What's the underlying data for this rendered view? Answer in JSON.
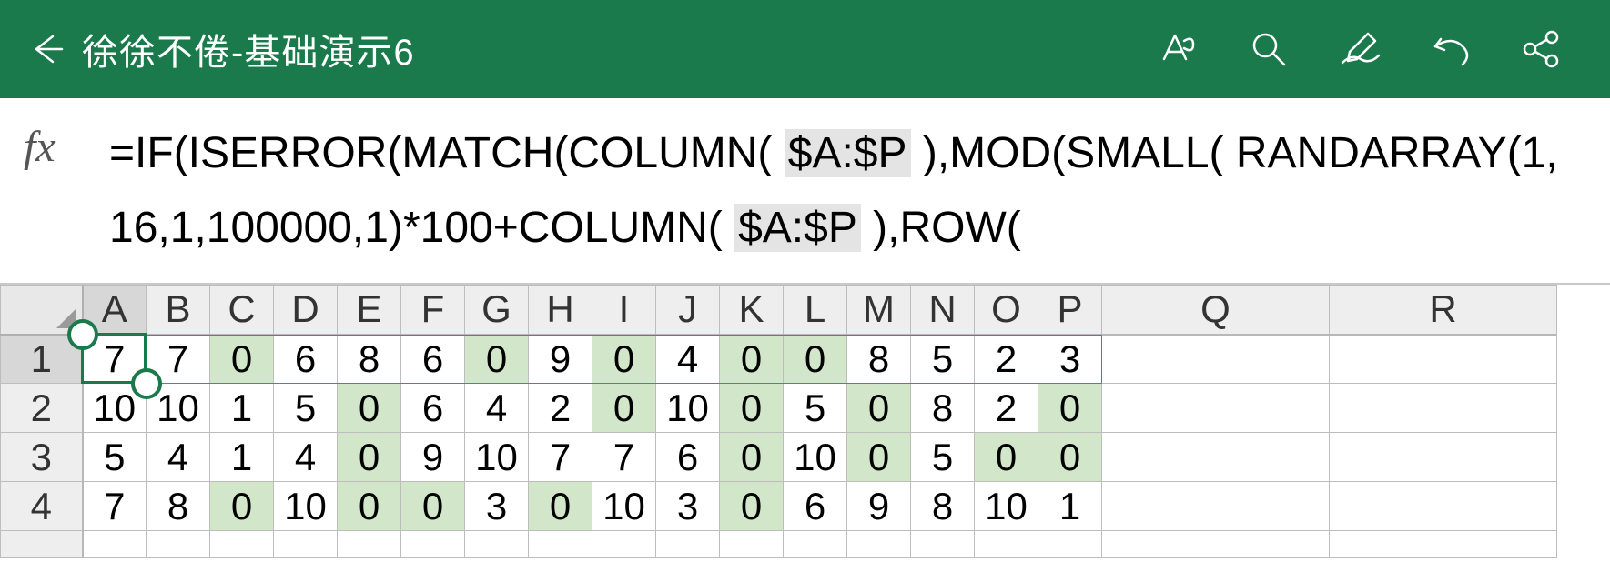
{
  "app": {
    "title": "徐徐不倦-基础演示6"
  },
  "toolbar": {
    "icons": {
      "back": "back-arrow",
      "format": "text-format",
      "search": "search",
      "draw": "pen",
      "undo": "undo",
      "share": "share"
    }
  },
  "formula_bar": {
    "fx_label": "fx",
    "segments": [
      {
        "t": "=IF(ISERROR(MATCH(COLUMN( "
      },
      {
        "t": "$A:$P",
        "hl": true
      },
      {
        "t": " ),MOD(SMALL( RANDARRAY(1,16,1,100000,1)*100+COLUMN( "
      },
      {
        "t": "$A:$P",
        "hl": true
      },
      {
        "t": " ),ROW("
      }
    ]
  },
  "grid": {
    "columns": [
      "A",
      "B",
      "C",
      "D",
      "E",
      "F",
      "G",
      "H",
      "I",
      "J",
      "K",
      "L",
      "M",
      "N",
      "O",
      "P",
      "Q",
      "R"
    ],
    "wide_columns": [
      "Q",
      "R"
    ],
    "selected_column": "A",
    "selected_row": 1,
    "active_cell": "A1",
    "spill_range": "A1:P1",
    "rows": [
      {
        "n": 1,
        "cells": [
          7,
          7,
          0,
          6,
          8,
          6,
          0,
          9,
          0,
          4,
          0,
          0,
          8,
          5,
          2,
          3,
          "",
          ""
        ]
      },
      {
        "n": 2,
        "cells": [
          10,
          10,
          1,
          5,
          0,
          6,
          4,
          2,
          0,
          10,
          0,
          5,
          0,
          8,
          2,
          0,
          "",
          ""
        ]
      },
      {
        "n": 3,
        "cells": [
          5,
          4,
          1,
          4,
          0,
          9,
          10,
          7,
          7,
          6,
          0,
          10,
          0,
          5,
          0,
          0,
          "",
          ""
        ]
      },
      {
        "n": 4,
        "cells": [
          7,
          8,
          0,
          10,
          0,
          0,
          3,
          0,
          10,
          3,
          0,
          6,
          9,
          8,
          10,
          1,
          "",
          ""
        ]
      }
    ],
    "highlight_value": 0
  },
  "colors": {
    "brand": "#1a7a4c",
    "zero_fill": "#d2e7c9",
    "header_fill": "#eeeeee",
    "highlight_grey": "#e4e4e4"
  },
  "chart_data": {
    "type": "table",
    "columns": [
      "A",
      "B",
      "C",
      "D",
      "E",
      "F",
      "G",
      "H",
      "I",
      "J",
      "K",
      "L",
      "M",
      "N",
      "O",
      "P"
    ],
    "rows": [
      [
        7,
        7,
        0,
        6,
        8,
        6,
        0,
        9,
        0,
        4,
        0,
        0,
        8,
        5,
        2,
        3
      ],
      [
        10,
        10,
        1,
        5,
        0,
        6,
        4,
        2,
        0,
        10,
        0,
        5,
        0,
        8,
        2,
        0
      ],
      [
        5,
        4,
        1,
        4,
        0,
        9,
        10,
        7,
        7,
        6,
        0,
        10,
        0,
        5,
        0,
        0
      ],
      [
        7,
        8,
        0,
        10,
        0,
        0,
        3,
        0,
        10,
        3,
        0,
        6,
        9,
        8,
        10,
        1
      ]
    ],
    "note": "Cells with value 0 are highlighted green"
  }
}
